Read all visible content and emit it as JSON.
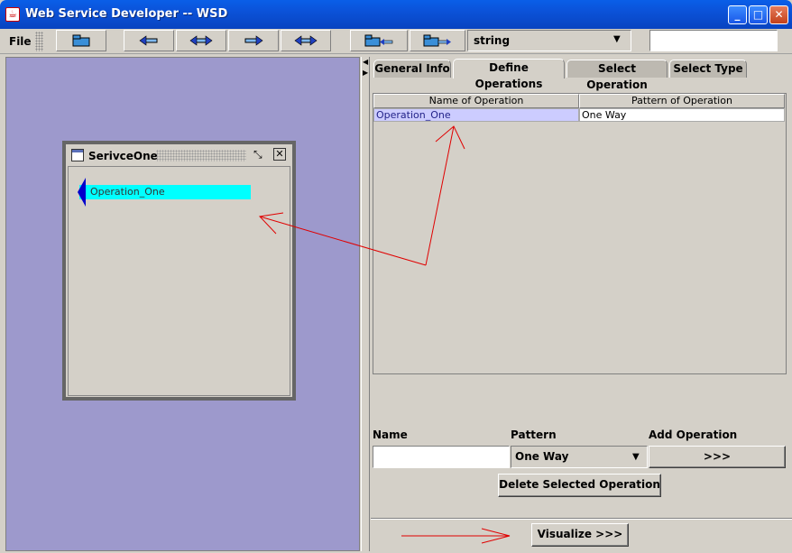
{
  "window": {
    "title": "Web Service Developer -- WSD",
    "app_icon": "java-cup-icon",
    "controls": {
      "minimize": "minimize-icon",
      "maximize": "maximize-icon",
      "close": "close-icon"
    }
  },
  "toolbar": {
    "file_menu": "File",
    "type_select": {
      "value": "string"
    },
    "search_value": ""
  },
  "service_window": {
    "title": "SerivceOne",
    "operation_node": "Operation_One"
  },
  "tabs": [
    {
      "label": "General Info",
      "active": false
    },
    {
      "label": "Define Operations",
      "active": true
    },
    {
      "label": "Select Operation",
      "active": false
    },
    {
      "label": "Select Type",
      "active": false
    }
  ],
  "operations_table": {
    "columns": [
      "Name of Operation",
      "Pattern of Operation"
    ],
    "rows": [
      {
        "name": "Operation_One",
        "pattern": "One Way"
      }
    ]
  },
  "form": {
    "name_label": "Name",
    "pattern_label": "Pattern",
    "add_label": "Add Operation",
    "name_value": "",
    "pattern_value": "One Way",
    "add_button": ">>>",
    "delete_button": "Delete Selected Operation",
    "visualize_button": "Visualize >>>"
  },
  "colors": {
    "canvas": "#9d99cc",
    "operation_node": "#00ffff",
    "annotation": "#e00000"
  }
}
